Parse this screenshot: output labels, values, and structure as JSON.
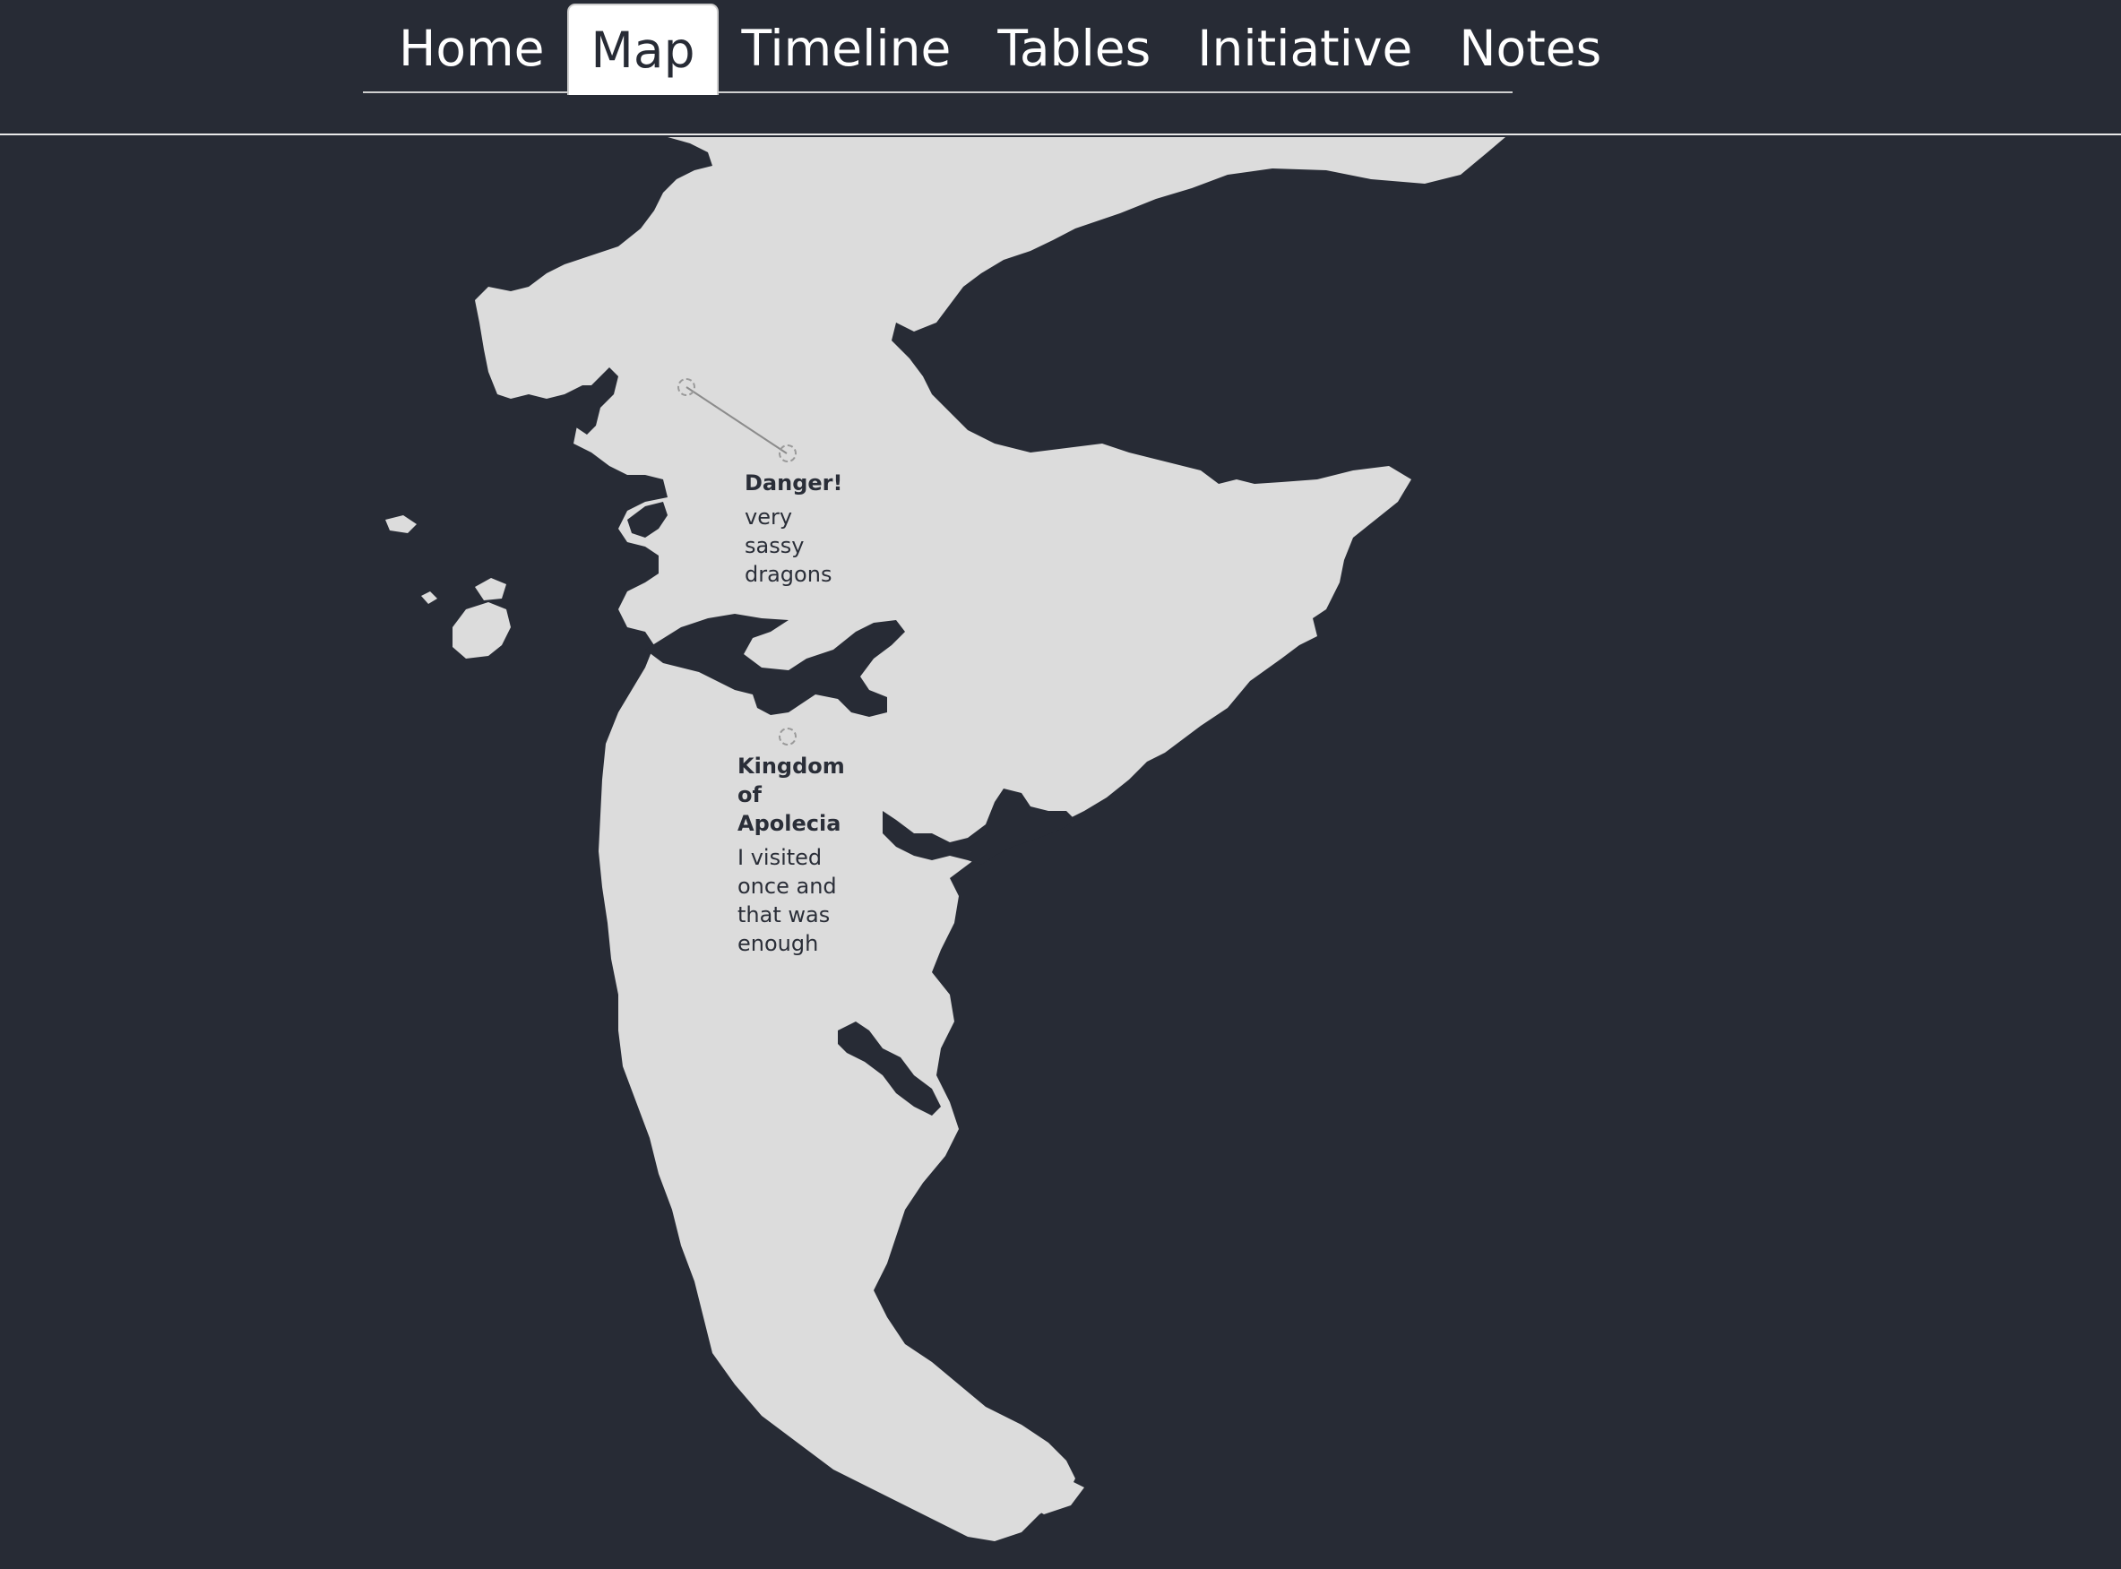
{
  "nav": {
    "tabs": [
      {
        "label": "Home",
        "active": false
      },
      {
        "label": "Map",
        "active": true
      },
      {
        "label": "Timeline",
        "active": false
      },
      {
        "label": "Tables",
        "active": false
      },
      {
        "label": "Initiative",
        "active": false
      },
      {
        "label": "Notes",
        "active": false
      }
    ]
  },
  "map": {
    "land_color": "#dcdcdc",
    "water_color": "#272b35",
    "markers": [
      {
        "title": "Danger!",
        "body": "very sassy dragons"
      },
      {
        "title": "Kingdom of Apolecia",
        "body": "I visited once and that was enough"
      }
    ]
  }
}
